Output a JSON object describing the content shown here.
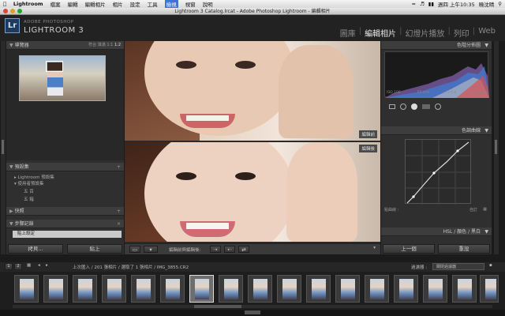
{
  "menubar": {
    "items": [
      "Lightroom",
      "檔案",
      "編輯",
      "編輯相片",
      "相片",
      "設定",
      "工具",
      "檢視",
      "視窗",
      "說明"
    ],
    "clock": "週四 上午10:35",
    "user": "曉沈晴"
  },
  "window": {
    "title": "Lightroom 3 Catalog.lrcat - Adobe Photoshop Lightroom - 編輯相片"
  },
  "identity": {
    "brand_top": "ADOBE PHOTOSHOP",
    "brand_name": "LIGHTROOM 3",
    "logo": "Lr"
  },
  "modules": [
    "圖庫",
    "編輯相片",
    "幻燈片播放",
    "列印",
    "Web"
  ],
  "left_panel": {
    "navigator": {
      "title": "導覽器",
      "zoom": [
        "符合",
        "填滿",
        "1:1",
        "1:2"
      ]
    },
    "presets": {
      "title": "預設集",
      "groups": [
        "Lightroom 預設集",
        "使用者預設集"
      ],
      "items": [
        "五 百",
        "五 箱"
      ]
    },
    "snapshots": {
      "title": "快照"
    },
    "history": {
      "title": "步驟記錄",
      "items": [
        "貼上設定"
      ]
    },
    "copy_button": "拷貝...",
    "paste_button": "貼上"
  },
  "center": {
    "before_label": "編輯前",
    "after_label": "編輯後",
    "toolbar_label": "編輯前與編輯後:"
  },
  "right_panel": {
    "histogram": {
      "title": "色階分佈圖",
      "iso": "ISO 100",
      "focal": "55 mm",
      "aperture": "f / 4.0",
      "shutter": "1/200 秒"
    },
    "tone_curve": {
      "title": "色調曲線",
      "adjust": "點曲線 :",
      "mode": "自訂"
    },
    "hsl": {
      "title": "HSL / 顏色 / 黑白"
    },
    "prev_button": "上一個",
    "reset_button": "重設"
  },
  "filmstrip": {
    "pages": [
      "1",
      "2"
    ],
    "breadcrumb": "上次匯入 / 201 張相片 / 選取了 1 張相片 / IMG_3855.CR2",
    "filter_label": "過濾器 :",
    "filter_value": "關閉過濾器",
    "thumb_count": 17
  },
  "colors": {
    "accent": "#3875d7",
    "panel": "#3d3d3d",
    "bg": "#1b1b1b"
  }
}
